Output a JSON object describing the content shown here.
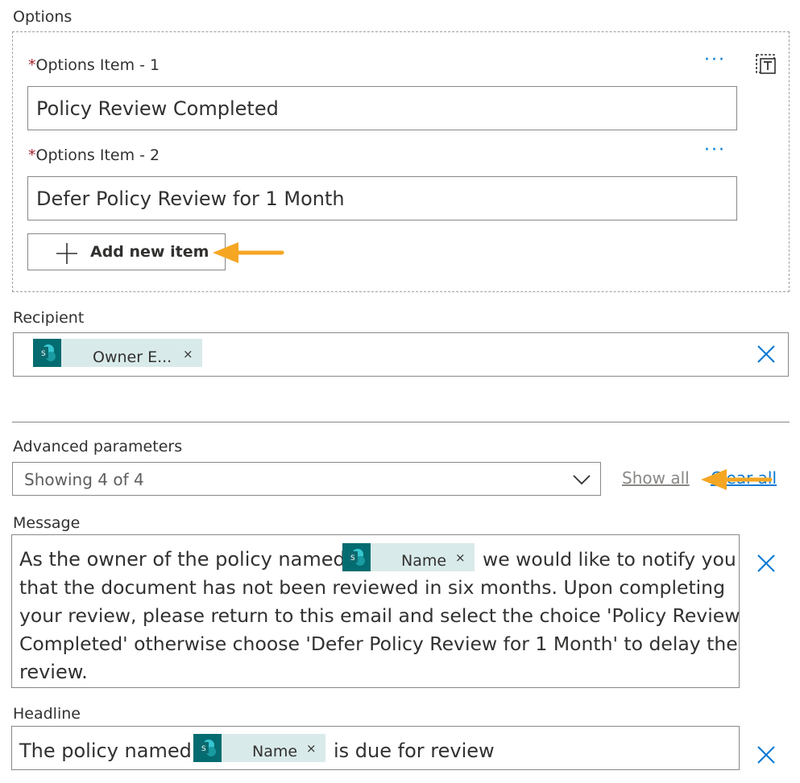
{
  "options": {
    "section_label": "Options",
    "item1": {
      "label": "Options Item - 1",
      "value": "Policy Review Completed"
    },
    "item2": {
      "label": "Options Item - 2",
      "value": "Defer Policy Review for 1 Month"
    },
    "required_mark": "*",
    "more_glyph": "···",
    "add_button_label": "Add new item"
  },
  "recipient": {
    "label": "Recipient",
    "token_label": "Owner E...",
    "token_remove": "×"
  },
  "advanced": {
    "label": "Advanced parameters",
    "select_value": "Showing 4 of 4",
    "show_all": "Show all",
    "clear_all": "Clear all"
  },
  "message": {
    "label": "Message",
    "text_before": "As the owner of the policy named",
    "token_label": "Name",
    "token_remove": "×",
    "text_line1_after": "we would like to notify you",
    "text_line2": "that the document has not been reviewed in six months. Upon completing",
    "text_line3": "your review, please return to this email and select the choice 'Policy Review",
    "text_line4": "Completed' otherwise choose 'Defer Policy Review for 1 Month' to delay the",
    "text_line5": "review."
  },
  "headline": {
    "label": "Headline",
    "text_before": "The policy named",
    "token_label": "Name",
    "token_remove": "×",
    "text_after": "is due for review"
  },
  "colors": {
    "accent": "#0078d4",
    "arrow": "#f5a623",
    "token_icon": "#036c70",
    "token_bg": "#d9eaea",
    "required": "#a4262c"
  },
  "icons": [
    "ellipsis-icon",
    "delete-card-icon",
    "plus-icon",
    "sharepoint-icon",
    "close-icon",
    "chevron-down-icon",
    "callout-arrow-icon"
  ]
}
